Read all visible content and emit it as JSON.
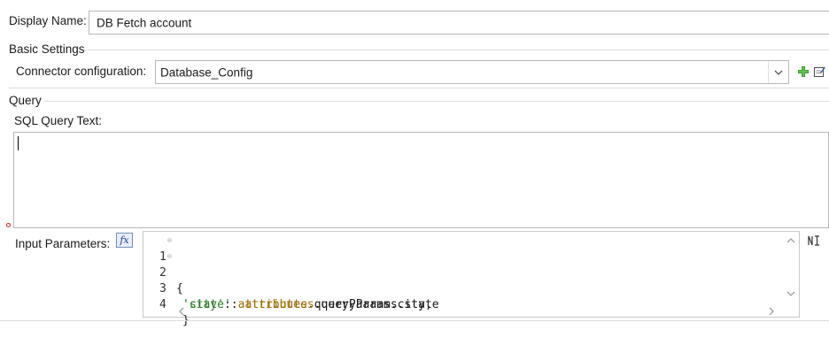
{
  "display_name": {
    "label": "Display Name:",
    "value": "DB Fetch account"
  },
  "basic_settings": {
    "section_title": "Basic Settings",
    "connector_label": "Connector configuration:",
    "connector_value": "Database_Config"
  },
  "query": {
    "section_title": "Query",
    "sql_label": "SQL Query Text:",
    "sql_value": ""
  },
  "input_parameters": {
    "label": "Input Parameters:",
    "fx_label": "fx",
    "lines": [
      {
        "num": "1",
        "text": "{"
      },
      {
        "num": "2",
        "str": "'city'",
        "sep": ": ",
        "obj": "attributes",
        "rest": ".queryParams.city,"
      },
      {
        "num": "3",
        "str": "'state'",
        "sep": ": ",
        "obj": "attributes",
        "rest": ".queryParams.state"
      },
      {
        "num": "4",
        "text": "}"
      }
    ]
  },
  "icons": {
    "add": "plus-icon",
    "edit": "edit-icon",
    "dropdown": "chevron-down-icon",
    "expand": "expand-editor-icon"
  }
}
